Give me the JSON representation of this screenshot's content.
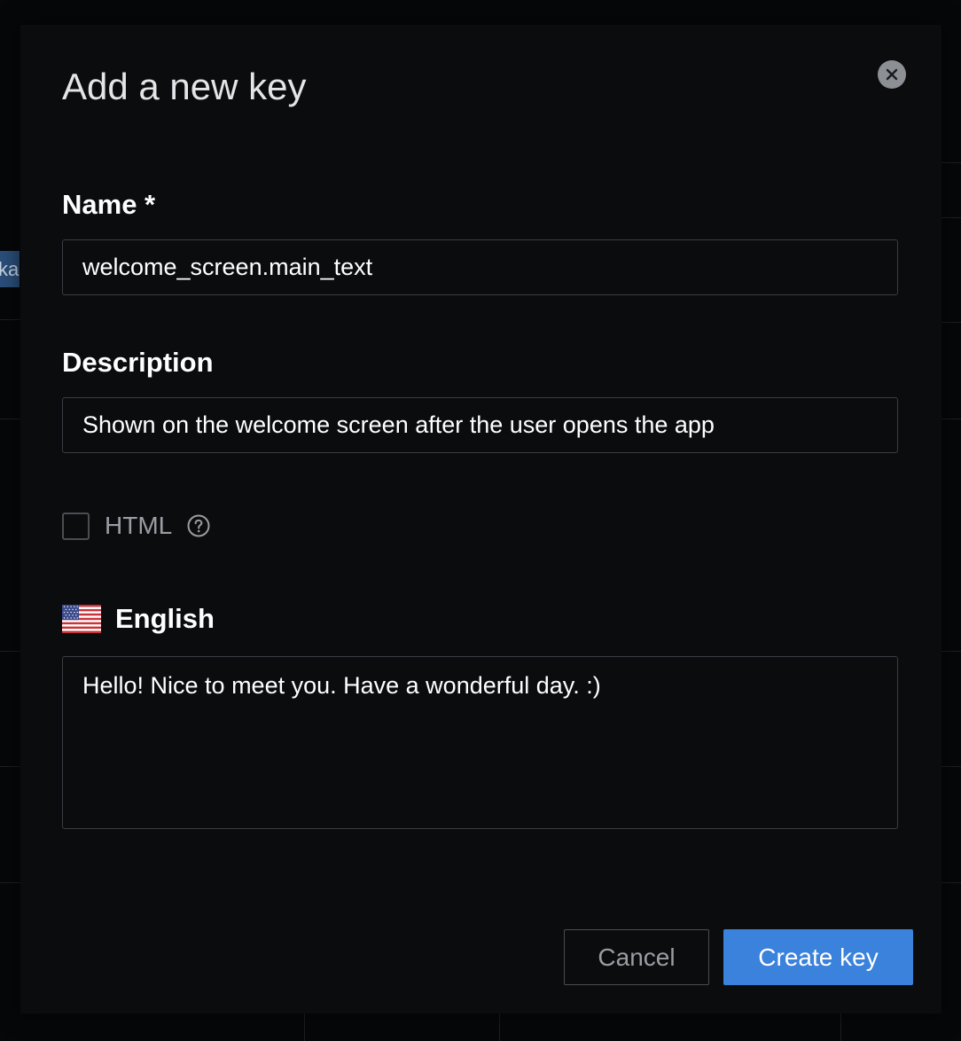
{
  "background": {
    "chip_text": "ka"
  },
  "modal": {
    "title": "Add a new key",
    "close_icon": "close-icon"
  },
  "form": {
    "name_label": "Name *",
    "name_value": "welcome_screen.main_text",
    "description_label": "Description",
    "description_value": "Shown on the welcome screen after the user opens the app",
    "html_label": "HTML",
    "html_checked": false,
    "help_icon": "question-circle-icon",
    "language": {
      "flag_icon": "us-flag-icon",
      "label": "English",
      "translation_value": "Hello! Nice to meet you. Have a wonderful day. :)"
    }
  },
  "actions": {
    "cancel_label": "Cancel",
    "create_label": "Create key"
  },
  "colors": {
    "accent": "#3a82dc",
    "modal_bg": "#0b0c0e",
    "page_bg": "#060708",
    "border": "#3a3d42",
    "muted_text": "#9a9da2"
  }
}
